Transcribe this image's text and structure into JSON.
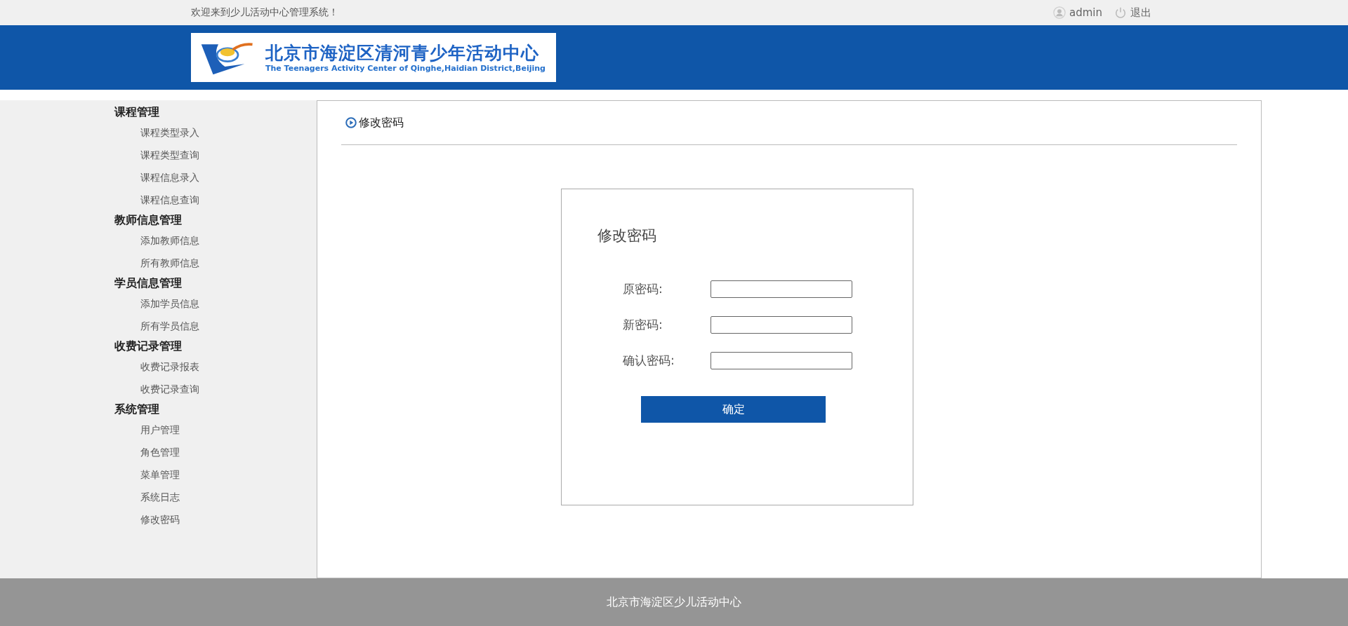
{
  "top_bar": {
    "welcome": "欢迎来到少儿活动中心管理系统！",
    "user": "admin",
    "logout": "退出"
  },
  "logo": {
    "title": "北京市海淀区清河青少年活动中心",
    "subtitle": "The Teenagers Activity Center of Qinghe,Haidian District,Beijing"
  },
  "sidebar": {
    "groups": [
      {
        "label": "课程管理",
        "children": [
          {
            "label": "课程类型录入"
          },
          {
            "label": "课程类型查询"
          },
          {
            "label": "课程信息录入"
          },
          {
            "label": "课程信息查询"
          }
        ]
      },
      {
        "label": "教师信息管理",
        "children": [
          {
            "label": "添加教师信息"
          },
          {
            "label": "所有教师信息"
          }
        ]
      },
      {
        "label": "学员信息管理",
        "children": [
          {
            "label": "添加学员信息"
          },
          {
            "label": "所有学员信息"
          }
        ]
      },
      {
        "label": "收费记录管理",
        "children": [
          {
            "label": "收费记录报表"
          },
          {
            "label": "收费记录查询"
          }
        ]
      },
      {
        "label": "系统管理",
        "children": [
          {
            "label": "用户管理"
          },
          {
            "label": "角色管理"
          },
          {
            "label": "菜单管理"
          },
          {
            "label": "系统日志"
          },
          {
            "label": "修改密码"
          }
        ]
      }
    ]
  },
  "content": {
    "heading": "修改密码",
    "form": {
      "title": "修改密码",
      "fields": [
        {
          "label": "原密码:"
        },
        {
          "label": "新密码:"
        },
        {
          "label": "确认密码:"
        }
      ],
      "submit": "确定"
    }
  },
  "footer": {
    "text": "北京市海淀区少儿活动中心"
  }
}
